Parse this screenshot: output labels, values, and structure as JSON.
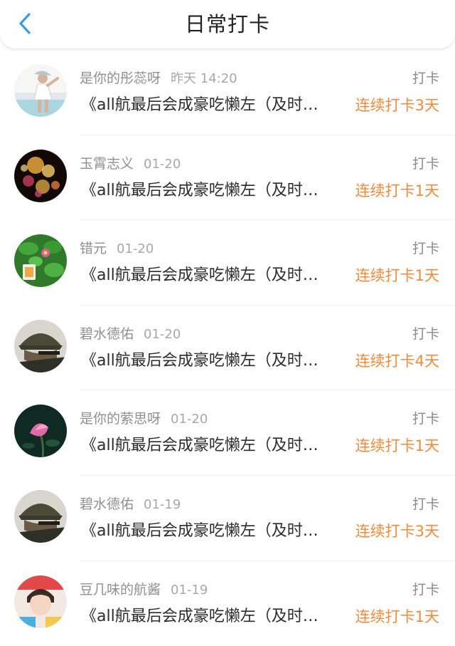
{
  "header": {
    "title": "日常打卡",
    "back_icon": "chevron-left-icon"
  },
  "colors": {
    "accent": "#f08a3c",
    "back": "#3c9be0"
  },
  "items": [
    {
      "name": "是你的彤蕊呀",
      "time": "昨天 14:20",
      "content": "《all航最后会成豪吃懒左（及时…",
      "action": "打卡",
      "streak": "连续打卡3天"
    },
    {
      "name": "玉霄志义",
      "time": "01-20",
      "content": "《all航最后会成豪吃懒左（及时…",
      "action": "打卡",
      "streak": "连续打卡1天"
    },
    {
      "name": "错元",
      "time": "01-20",
      "content": "《all航最后会成豪吃懒左（及时…",
      "action": "打卡",
      "streak": "连续打卡1天"
    },
    {
      "name": "碧水德佑",
      "time": "01-20",
      "content": "《all航最后会成豪吃懒左（及时…",
      "action": "打卡",
      "streak": "连续打卡4天"
    },
    {
      "name": "是你的萦思呀",
      "time": "01-20",
      "content": "《all航最后会成豪吃懒左（及时…",
      "action": "打卡",
      "streak": "连续打卡1天"
    },
    {
      "name": "碧水德佑",
      "time": "01-19",
      "content": "《all航最后会成豪吃懒左（及时…",
      "action": "打卡",
      "streak": "连续打卡3天"
    },
    {
      "name": "豆几味的航酱",
      "time": "01-19",
      "content": "《all航最后会成豪吃懒左（及时…",
      "action": "打卡",
      "streak": "连续打卡1天"
    }
  ]
}
